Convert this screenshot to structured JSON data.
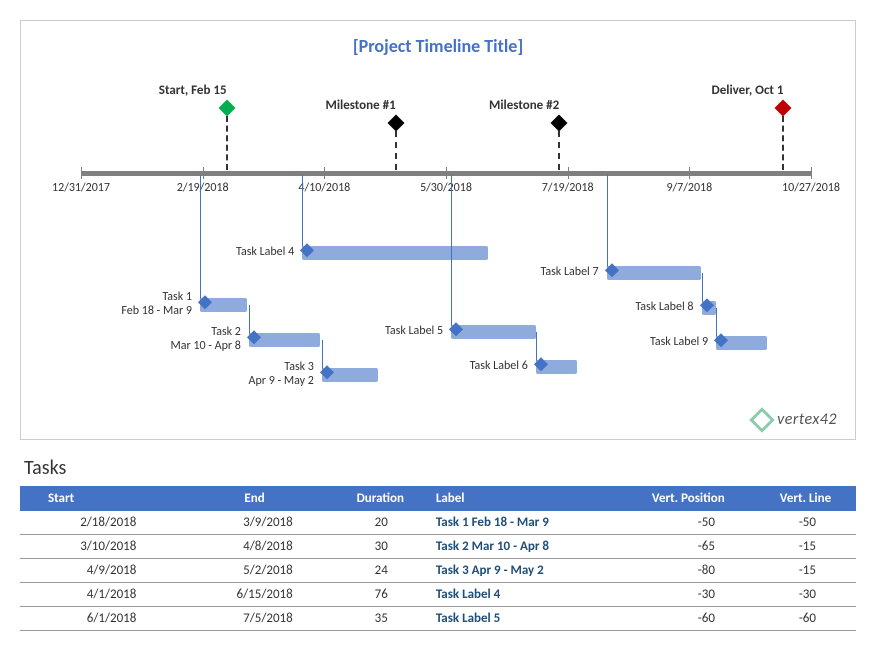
{
  "chart_data": {
    "type": "bar",
    "title": "[Project Timeline Title]",
    "x_ticks": [
      "12/31/2017",
      "2/19/2018",
      "4/10/2018",
      "5/30/2018",
      "7/19/2018",
      "9/7/2018",
      "10/27/2018"
    ],
    "x_range_days": 300,
    "x_start": "12/31/2017",
    "milestones": [
      {
        "label": "Start, Feb 15",
        "date": "2/15/2018",
        "pos": 0.153,
        "color": "#00B050",
        "drop": 60
      },
      {
        "label": "Milestone #1",
        "date": "4/25/2018",
        "pos": 0.383,
        "color": "#000000",
        "drop": 45
      },
      {
        "label": "Milestone #2",
        "date": "7/1/2018",
        "pos": 0.607,
        "color": "#000000",
        "drop": 45
      },
      {
        "label": "Deliver, Oct 1",
        "date": "10/1/2018",
        "pos": 0.913,
        "color": "#C00000",
        "drop": 60
      }
    ],
    "tasks": [
      {
        "label": "Task Label 4",
        "startPos": 0.303,
        "endPos": 0.557,
        "vert": 78,
        "leaderTop": 0,
        "labelLines": [
          "Task Label 4"
        ]
      },
      {
        "label": "Task 1",
        "startPos": 0.163,
        "endPos": 0.227,
        "vert": 130,
        "leaderTop": 0,
        "labelLines": [
          "Task 1",
          "Feb 18 - Mar 9"
        ]
      },
      {
        "label": "Task 2",
        "startPos": 0.23,
        "endPos": 0.327,
        "vert": 165,
        "leaderTop": 130,
        "labelLines": [
          "Task 2",
          "Mar 10 - Apr 8"
        ]
      },
      {
        "label": "Task 3",
        "startPos": 0.33,
        "endPos": 0.407,
        "vert": 200,
        "leaderTop": 165,
        "labelLines": [
          "Task 3",
          "Apr 9 - May 2"
        ]
      },
      {
        "label": "Task Label 5",
        "startPos": 0.507,
        "endPos": 0.623,
        "vert": 157,
        "leaderTop": 0,
        "labelLines": [
          "Task Label 5"
        ]
      },
      {
        "label": "Task Label 6",
        "startPos": 0.623,
        "endPos": 0.68,
        "vert": 192,
        "leaderTop": 157,
        "labelLines": [
          "Task Label 6"
        ]
      },
      {
        "label": "Task Label 7",
        "startPos": 0.72,
        "endPos": 0.85,
        "vert": 98,
        "leaderTop": 0,
        "labelLines": [
          "Task Label 7"
        ]
      },
      {
        "label": "Task Label 8",
        "startPos": 0.85,
        "endPos": 0.87,
        "vert": 133,
        "leaderTop": 98,
        "labelLines": [
          "Task Label 8"
        ]
      },
      {
        "label": "Task Label 9",
        "startPos": 0.87,
        "endPos": 0.94,
        "vert": 168,
        "leaderTop": 133,
        "labelLines": [
          "Task Label 9"
        ]
      }
    ]
  },
  "logo_text": "vertex42",
  "table": {
    "title": "Tasks",
    "headers": [
      "Start",
      "End",
      "Duration",
      "Label",
      "Vert. Position",
      "Vert. Line"
    ],
    "rows": [
      {
        "start": "2/18/2018",
        "end": "3/9/2018",
        "duration": "20",
        "label": "Task 1  Feb 18 - Mar 9",
        "vpos": "-50",
        "vline": "-50"
      },
      {
        "start": "3/10/2018",
        "end": "4/8/2018",
        "duration": "30",
        "label": "Task 2  Mar 10 - Apr 8",
        "vpos": "-65",
        "vline": "-15"
      },
      {
        "start": "4/9/2018",
        "end": "5/2/2018",
        "duration": "24",
        "label": "Task 3  Apr 9 - May 2",
        "vpos": "-80",
        "vline": "-15"
      },
      {
        "start": "4/1/2018",
        "end": "6/15/2018",
        "duration": "76",
        "label": "Task Label 4",
        "vpos": "-30",
        "vline": "-30"
      },
      {
        "start": "6/1/2018",
        "end": "7/5/2018",
        "duration": "35",
        "label": "Task Label 5",
        "vpos": "-60",
        "vline": "-60"
      }
    ]
  }
}
